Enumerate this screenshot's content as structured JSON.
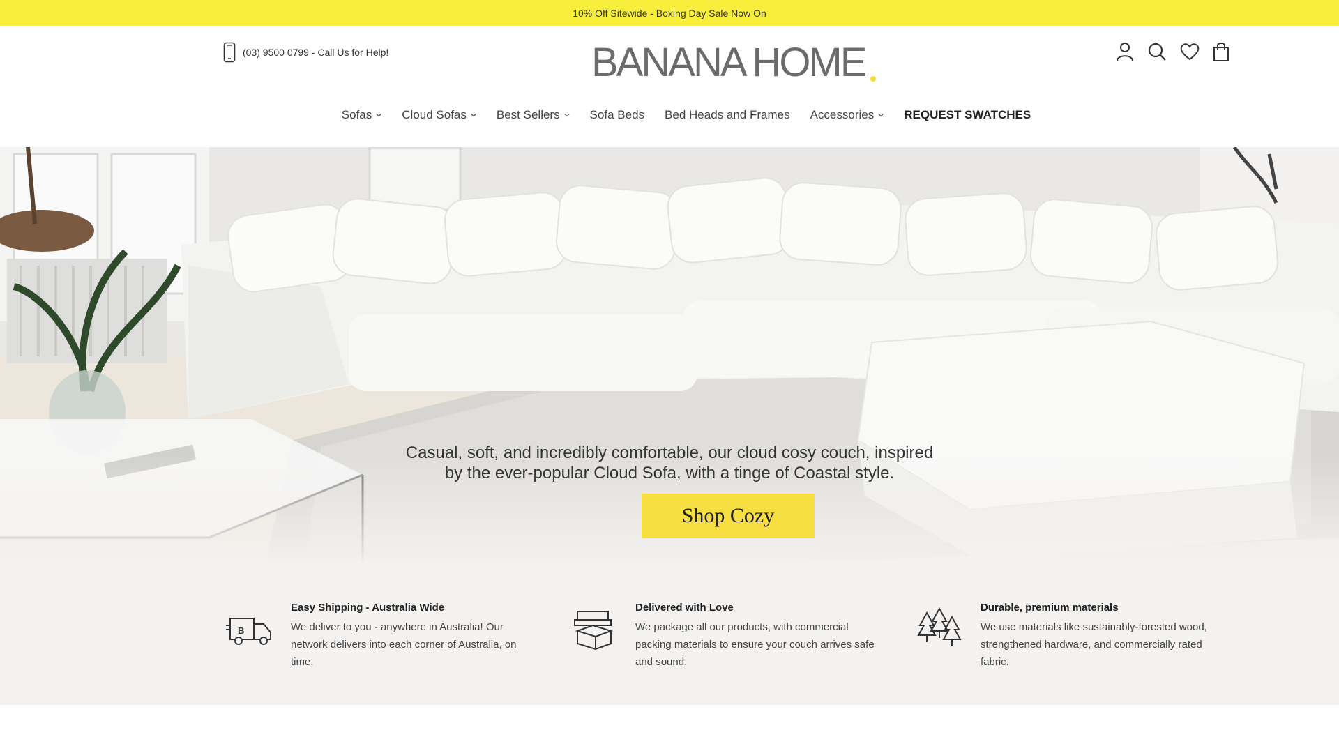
{
  "announcement": "10% Off Sitewide - Boxing Day Sale Now On",
  "header": {
    "phone": "(03) 9500 0799 - Call Us for Help!",
    "logo": "BANANA HOME"
  },
  "nav": {
    "items": [
      {
        "label": "Sofas",
        "dropdown": true
      },
      {
        "label": "Cloud Sofas",
        "dropdown": true
      },
      {
        "label": "Best Sellers",
        "dropdown": true
      },
      {
        "label": "Sofa Beds",
        "dropdown": false
      },
      {
        "label": "Bed Heads and Frames",
        "dropdown": false
      },
      {
        "label": "Accessories",
        "dropdown": true
      },
      {
        "label": "REQUEST SWATCHES",
        "dropdown": false
      }
    ]
  },
  "hero": {
    "tagline_line1": "Casual, soft, and incredibly comfortable, our cloud cosy couch, inspired",
    "tagline_line2": "by the ever-popular Cloud Sofa, with a tinge of Coastal style.",
    "cta": "Shop Cozy"
  },
  "features": [
    {
      "title": "Easy Shipping - Australia Wide",
      "description": "We deliver to you - anywhere in Australia! Our network delivers into each corner of Australia, on time.",
      "icon": "delivery-truck-icon"
    },
    {
      "title": "Delivered with Love",
      "description": "We package all our products, with commercial packing materials to ensure your couch arrives safe and sound.",
      "icon": "sofa-box-icon"
    },
    {
      "title": "Durable, premium materials",
      "description": "We use materials like sustainably-forested wood, strengthened hardware, and commercially rated fabric.",
      "icon": "trees-icon"
    }
  ],
  "colors": {
    "announcement_bg": "#f8ef3d",
    "cta_bg": "#f8df41",
    "features_bg": "#f4f2f0"
  }
}
